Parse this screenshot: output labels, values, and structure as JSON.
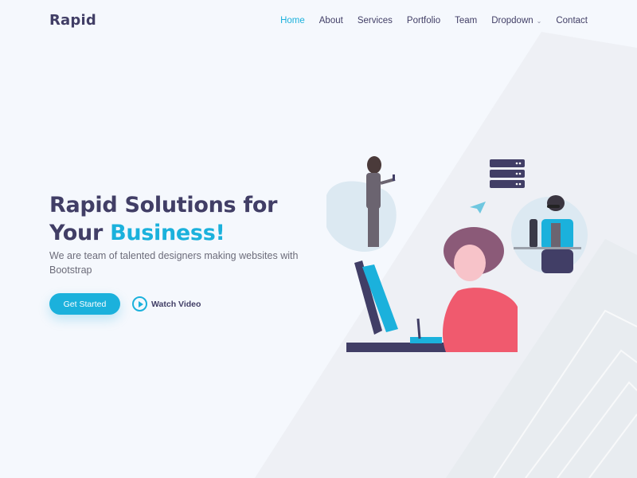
{
  "header": {
    "logo": "Rapid",
    "nav": [
      {
        "label": "Home",
        "active": true
      },
      {
        "label": "About",
        "active": false
      },
      {
        "label": "Services",
        "active": false
      },
      {
        "label": "Portfolio",
        "active": false
      },
      {
        "label": "Team",
        "active": false
      },
      {
        "label": "Dropdown",
        "active": false,
        "has_dropdown": true
      },
      {
        "label": "Contact",
        "active": false
      }
    ]
  },
  "hero": {
    "title_line1": "Rapid Solutions for",
    "title_line2_prefix": "Your ",
    "title_accent": "Business!",
    "subtitle": "We are team of talented designers making websites with Bootstrap",
    "cta_primary": "Get Started",
    "cta_secondary": "Watch Video",
    "cta_secondary_icon": "play-circle-icon",
    "illustration": "team-working-illustration"
  },
  "colors": {
    "accent": "#1bb1dc",
    "heading": "#413e66",
    "background": "#f5f8fd"
  }
}
